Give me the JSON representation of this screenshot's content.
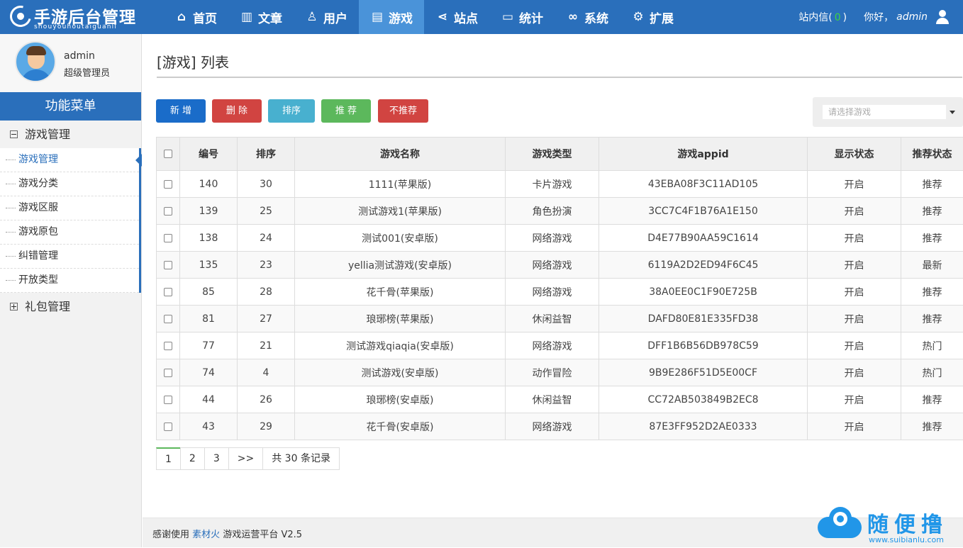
{
  "logo": {
    "name": "手游后台管理",
    "sub": "shouyouhoutaiguanli"
  },
  "nav": [
    {
      "label": "首页",
      "icon": "home-icon",
      "glyph": "⌂"
    },
    {
      "label": "文章",
      "icon": "bar-chart-icon",
      "glyph": "▥"
    },
    {
      "label": "用户",
      "icon": "user-icon",
      "glyph": "♙"
    },
    {
      "label": "游戏",
      "icon": "document-icon",
      "glyph": "▤"
    },
    {
      "label": "站点",
      "icon": "share-icon",
      "glyph": "⋖"
    },
    {
      "label": "统计",
      "icon": "monitor-icon",
      "glyph": "▭"
    },
    {
      "label": "系统",
      "icon": "link-icon",
      "glyph": "∞"
    },
    {
      "label": "扩展",
      "icon": "gear-icon",
      "glyph": "⚙"
    }
  ],
  "top_right": {
    "msg_label": "站内信",
    "msg_open": "(",
    "msg_count": "0",
    "msg_close": ")",
    "greeting": "你好，",
    "username": "admin"
  },
  "sidebar": {
    "username": "admin",
    "role": "超级管理员",
    "menu_title": "功能菜单",
    "group1": "游戏管理",
    "items": [
      "游戏管理",
      "游戏分类",
      "游戏区服",
      "游戏原包",
      "纠错管理",
      "开放类型"
    ],
    "group2": "礼包管理"
  },
  "main": {
    "title": "[游戏] 列表",
    "buttons": {
      "add": "新 增",
      "delete": "删 除",
      "sort": "排序",
      "recommend": "推 荐",
      "unrecommend": "不推荐"
    },
    "select_placeholder": "请选择游戏"
  },
  "table": {
    "headers": [
      "编号",
      "排序",
      "游戏名称",
      "游戏类型",
      "游戏appid",
      "显示状态",
      "推荐状态"
    ],
    "rows": [
      [
        "140",
        "30",
        "1111(苹果版)",
        "卡片游戏",
        "43EBA08F3C11AD105",
        "开启",
        "推荐"
      ],
      [
        "139",
        "25",
        "测试游戏1(苹果版)",
        "角色扮演",
        "3CC7C4F1B76A1E150",
        "开启",
        "推荐"
      ],
      [
        "138",
        "24",
        "测试001(安卓版)",
        "网络游戏",
        "D4E77B90AA59C1614",
        "开启",
        "推荐"
      ],
      [
        "135",
        "23",
        "yellia测试游戏(安卓版)",
        "网络游戏",
        "6119A2D2ED94F6C45",
        "开启",
        "最新"
      ],
      [
        "85",
        "28",
        "花千骨(苹果版)",
        "网络游戏",
        "38A0EE0C1F90E725B",
        "开启",
        "推荐"
      ],
      [
        "81",
        "27",
        "琅琊榜(苹果版)",
        "休闲益智",
        "DAFD80E81E335FD38",
        "开启",
        "推荐"
      ],
      [
        "77",
        "21",
        "测试游戏qiaqia(安卓版)",
        "网络游戏",
        "DFF1B6B56DB978C59",
        "开启",
        "热门"
      ],
      [
        "74",
        "4",
        "测试游戏(安卓版)",
        "动作冒险",
        "9B9E286F51D5E00CF",
        "开启",
        "热门"
      ],
      [
        "44",
        "26",
        "琅琊榜(安卓版)",
        "休闲益智",
        "CC72AB503849B2EC8",
        "开启",
        "推荐"
      ],
      [
        "43",
        "29",
        "花千骨(安卓版)",
        "网络游戏",
        "87E3FF952D2AE0333",
        "开启",
        "推荐"
      ]
    ]
  },
  "pager": {
    "pages": [
      "1",
      "2",
      "3"
    ],
    "next": ">>",
    "total": "共 30 条记录"
  },
  "footer": {
    "prefix": "感谢使用",
    "link": "素材火",
    "suffix": "游戏运营平台 V2.5"
  },
  "watermark": {
    "cn": "随便撸",
    "url": "www.suibianlu.com"
  }
}
